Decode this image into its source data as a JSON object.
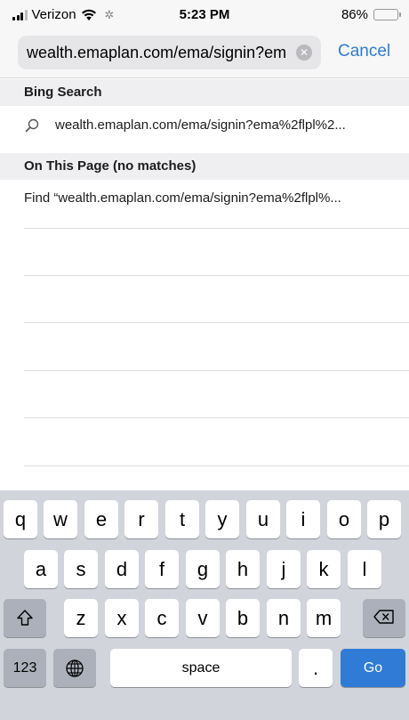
{
  "status_bar": {
    "carrier": "Verizon",
    "time": "5:23 PM",
    "battery_percent": "86%",
    "battery_level": 0.86,
    "battery_color": "#f2c500"
  },
  "url_bar": {
    "url": "wealth.emaplan.com/ema/signin?em",
    "cancel_label": "Cancel"
  },
  "suggestions": {
    "bing_header": "Bing Search",
    "bing_item": "wealth.emaplan.com/ema/signin?ema%2flpl%2...",
    "page_header": "On This Page (no matches)",
    "find_item": "Find “wealth.emaplan.com/ema/signin?ema%2flpl%..."
  },
  "keyboard": {
    "row1": [
      "q",
      "w",
      "e",
      "r",
      "t",
      "y",
      "u",
      "i",
      "o",
      "p"
    ],
    "row2": [
      "a",
      "s",
      "d",
      "f",
      "g",
      "h",
      "j",
      "k",
      "l"
    ],
    "row3": [
      "z",
      "x",
      "c",
      "v",
      "b",
      "n",
      "m"
    ],
    "numbers_label": "123",
    "space_label": "space",
    "period_label": ".",
    "go_label": "Go"
  },
  "colors": {
    "accent": "#2f7bd6",
    "keyboard_bg": "#d1d4da",
    "section_bg": "#efeff2"
  }
}
